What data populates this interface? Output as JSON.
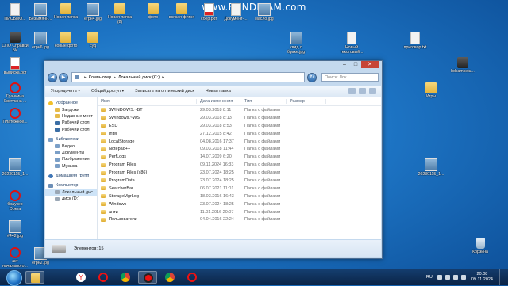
{
  "recorder_banner": "www.BANDICAM.com",
  "desktop_icons": [
    {
      "label": "ПИСЬМО...",
      "kind": "file"
    },
    {
      "label": "Безымянн...",
      "kind": "jpg"
    },
    {
      "label": "Новая папка",
      "kind": "folder"
    },
    {
      "label": "егрн4.jpg",
      "kind": "jpg"
    },
    {
      "label": "Новая папка (2)",
      "kind": "folder"
    },
    {
      "label": "фото",
      "kind": "folder"
    },
    {
      "label": "всякая фигня",
      "kind": "folder"
    },
    {
      "label": "сбер.pdf",
      "kind": "pdf"
    },
    {
      "label": "Документ-...",
      "kind": "file"
    },
    {
      "label": "масло.jpg",
      "kind": "jpg"
    },
    {
      "label": "СПО Справки БК",
      "kind": "app"
    },
    {
      "label": "егрн6.jpg",
      "kind": "jpg"
    },
    {
      "label": "новые фото",
      "kind": "folder"
    },
    {
      "label": "суд",
      "kind": "folder"
    },
    {
      "label": "свид о браке.jpg",
      "kind": "jpg"
    },
    {
      "label": "Новый текстовый...",
      "kind": "file"
    },
    {
      "label": "приговор.txt",
      "kind": "file"
    },
    {
      "label": "выписка.pdf",
      "kind": "pdf"
    },
    {
      "label": "bdcamsetu...",
      "kind": "app"
    },
    {
      "label": "Гранкина Светлана ...",
      "kind": "opera"
    },
    {
      "label": "Игры",
      "kind": "folder"
    },
    {
      "label": "Платежное...",
      "kind": "opera"
    },
    {
      "label": "20230115_1...",
      "kind": "jpg"
    },
    {
      "label": "20230115_1...",
      "kind": "jpg"
    },
    {
      "label": "браузер Opera",
      "kind": "opera"
    },
    {
      "label": "#442.jpg",
      "kind": "jpg"
    },
    {
      "label": "акт начального...",
      "kind": "opera"
    },
    {
      "label": "егрн2.jpg",
      "kind": "jpg"
    },
    {
      "label": "Корзина",
      "kind": "recycle"
    }
  ],
  "window": {
    "controls": {
      "minimize": "–",
      "maximize": "□",
      "close": "✕"
    },
    "address": {
      "root": "Компьютер",
      "drive": "Локальный диск (C:)"
    },
    "search_placeholder": "Поиск: Лок...",
    "toolbar": [
      "Упорядочить ▾",
      "Общий доступ ▾",
      "Записать на оптический диск",
      "Новая папка"
    ],
    "nav": {
      "favorites": "Избранное",
      "favorites_items": [
        "Загрузки",
        "Недавние мест",
        "Рабочий стол",
        "Рабочий стол"
      ],
      "libraries": "Библиотеки",
      "libraries_items": [
        "Видео",
        "Документы",
        "Изображения",
        "Музыка"
      ],
      "homegroup": "Домашняя групп",
      "computer": "Компьютер",
      "computer_items": [
        "Локальный дис",
        "диск (D:)"
      ]
    },
    "columns": [
      "Имя",
      "Дата изменения",
      "Тип",
      "Размер"
    ],
    "files": [
      {
        "name": "$WINDOWS.~BT",
        "date": "29.03.2018 8:11",
        "type": "Папка с файлами"
      },
      {
        "name": "$Windows.~WS",
        "date": "29.03.2018 8:13",
        "type": "Папка с файлами"
      },
      {
        "name": "ESD",
        "date": "29.03.2018 8:53",
        "type": "Папка с файлами"
      },
      {
        "name": "Intel",
        "date": "27.12.2015 8:42",
        "type": "Папка с файлами"
      },
      {
        "name": "LocalStorage",
        "date": "04.08.2016 17:37",
        "type": "Папка с файлами"
      },
      {
        "name": "Notepad++",
        "date": "09.03.2018 11:44",
        "type": "Папка с файлами"
      },
      {
        "name": "PerfLogs",
        "date": "14.07.2009 6:20",
        "type": "Папка с файлами"
      },
      {
        "name": "Program Files",
        "date": "09.11.2024 16:33",
        "type": "Папка с файлами"
      },
      {
        "name": "Program Files (x86)",
        "date": "23.07.2024 18:25",
        "type": "Папка с файлами"
      },
      {
        "name": "ProgramData",
        "date": "23.07.2024 18:25",
        "type": "Папка с файлами"
      },
      {
        "name": "SearcherBar",
        "date": "06.07.2021 11:01",
        "type": "Папка с файлами"
      },
      {
        "name": "StorageMgrLog",
        "date": "18.03.2016 16:43",
        "type": "Папка с файлами"
      },
      {
        "name": "Windows",
        "date": "23.07.2024 18:25",
        "type": "Папка с файлами"
      },
      {
        "name": "анти",
        "date": "11.01.2016 20:07",
        "type": "Папка с файлами"
      },
      {
        "name": "Пользователи",
        "date": "04.04.2016 22:24",
        "type": "Папка с файлами"
      }
    ],
    "status": "Элементов: 15"
  },
  "taskbar": {
    "apps": [
      "explorer",
      "yandex",
      "opera",
      "chrome",
      "bandicam",
      "chrome-2",
      "opera-2"
    ],
    "tray": {
      "lang": "RU",
      "time": "20:08",
      "date": "09.11.2024"
    }
  }
}
